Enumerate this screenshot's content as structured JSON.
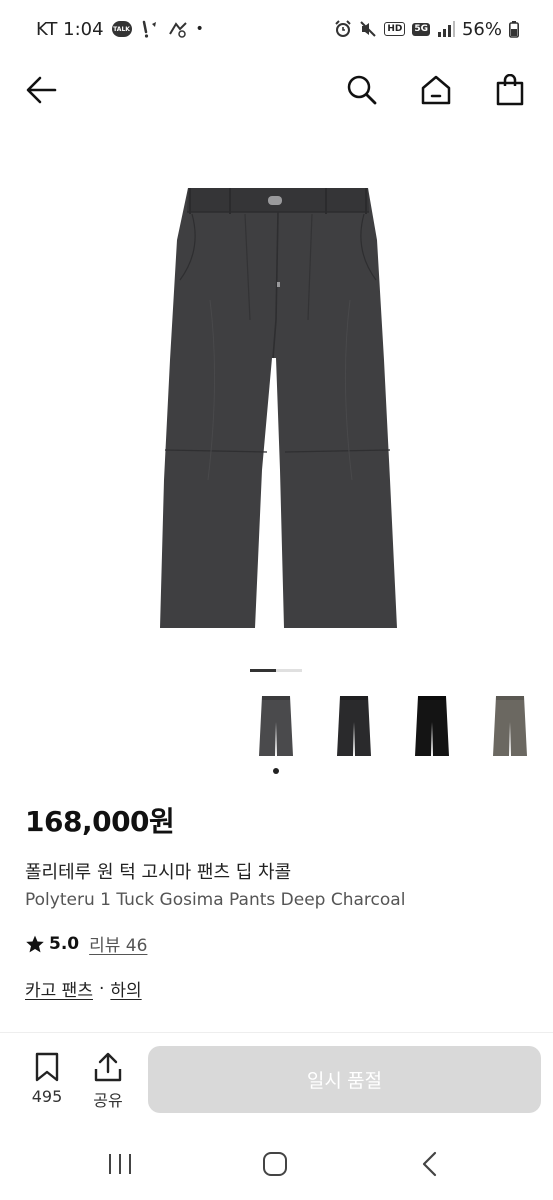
{
  "status_bar": {
    "carrier_time": "KT 1:04",
    "talk_badge": "TALK",
    "dot": "•",
    "hd_badge": "HD",
    "network_badge": "5G",
    "battery_text": "56%"
  },
  "nav": {
    "back_icon": "arrow-left-icon",
    "search_icon": "search-icon",
    "home_icon": "home-icon",
    "cart_icon": "shopping-bag-icon"
  },
  "gallery": {
    "page_count": 2,
    "current_page": 1,
    "thumbnails": [
      {
        "name": "charcoal-gray",
        "color": "#4a4a4c",
        "selected": true
      },
      {
        "name": "black",
        "color": "#2a2a2c",
        "selected": false
      },
      {
        "name": "deep-black",
        "color": "#141414",
        "selected": false
      },
      {
        "name": "olive-gray",
        "color": "#6b6861",
        "selected": false
      }
    ]
  },
  "product": {
    "price": "168,000원",
    "name_ko": "폴리테루 원 턱 고시마 팬츠 딥 차콜",
    "name_en": "Polyteru 1 Tuck Gosima Pants Deep Charcoal",
    "rating": "5.0",
    "review_label": "리뷰 46",
    "category_1": "카고 팬츠",
    "category_sep": "·",
    "category_2": "하의"
  },
  "actions": {
    "save_count": "495",
    "share_label": "공유",
    "buy_label": "일시 품절"
  },
  "colors": {
    "pants": "#3f3f41",
    "button_disabled": "#d9d9d9"
  }
}
